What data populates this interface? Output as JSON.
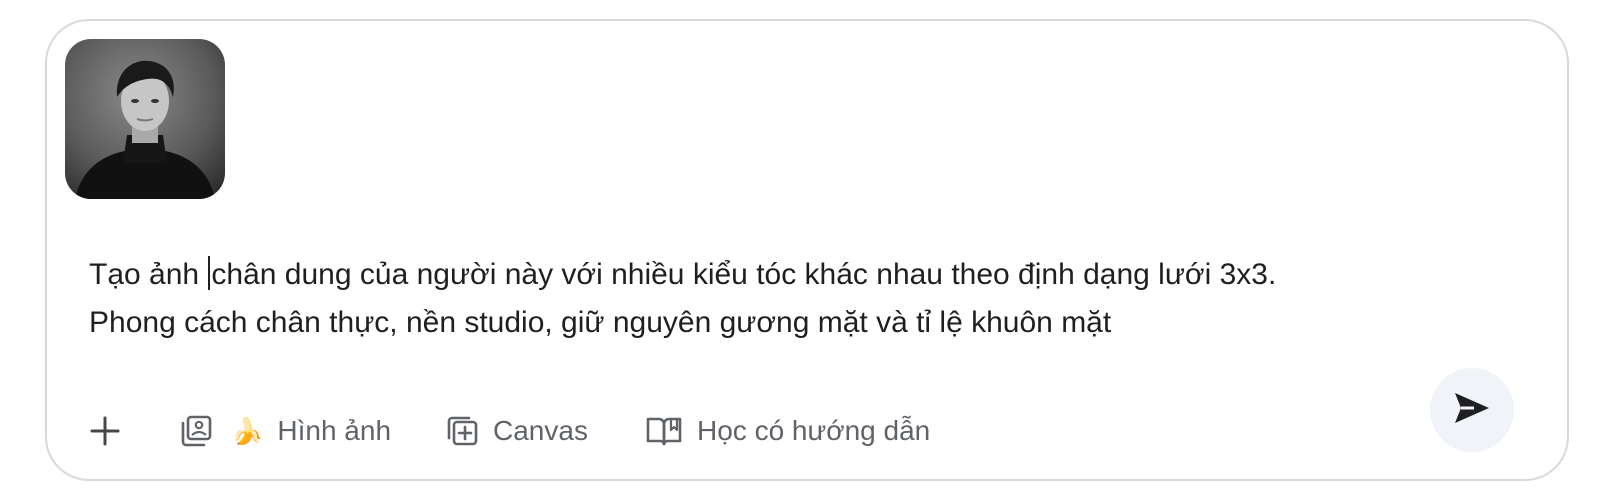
{
  "composer": {
    "attachment": {
      "alt": "Ảnh chân dung đen trắng"
    },
    "prompt": {
      "before_caret": "Tạo ảnh ",
      "after_caret": "chân dung của người này với nhiều kiểu tóc khác nhau theo định dạng lưới 3x3.\nPhong cách chân thực, nền studio, giữ nguyên gương mặt và tỉ lệ khuôn mặt"
    },
    "toolbar": {
      "add_icon": "plus-icon",
      "image_tool": {
        "icon": "image-stack-icon",
        "emoji": "🍌",
        "label": "Hình ảnh"
      },
      "canvas_tool": {
        "icon": "canvas-add-icon",
        "label": "Canvas"
      },
      "learn_tool": {
        "icon": "open-book-icon",
        "label": "Học có hướng dẫn"
      },
      "send_icon": "send-icon"
    },
    "colors": {
      "border": "#d9d9d9",
      "text": "#1f1f1f",
      "muted": "#5f6368",
      "send_bg": "#f0f4f9"
    }
  }
}
